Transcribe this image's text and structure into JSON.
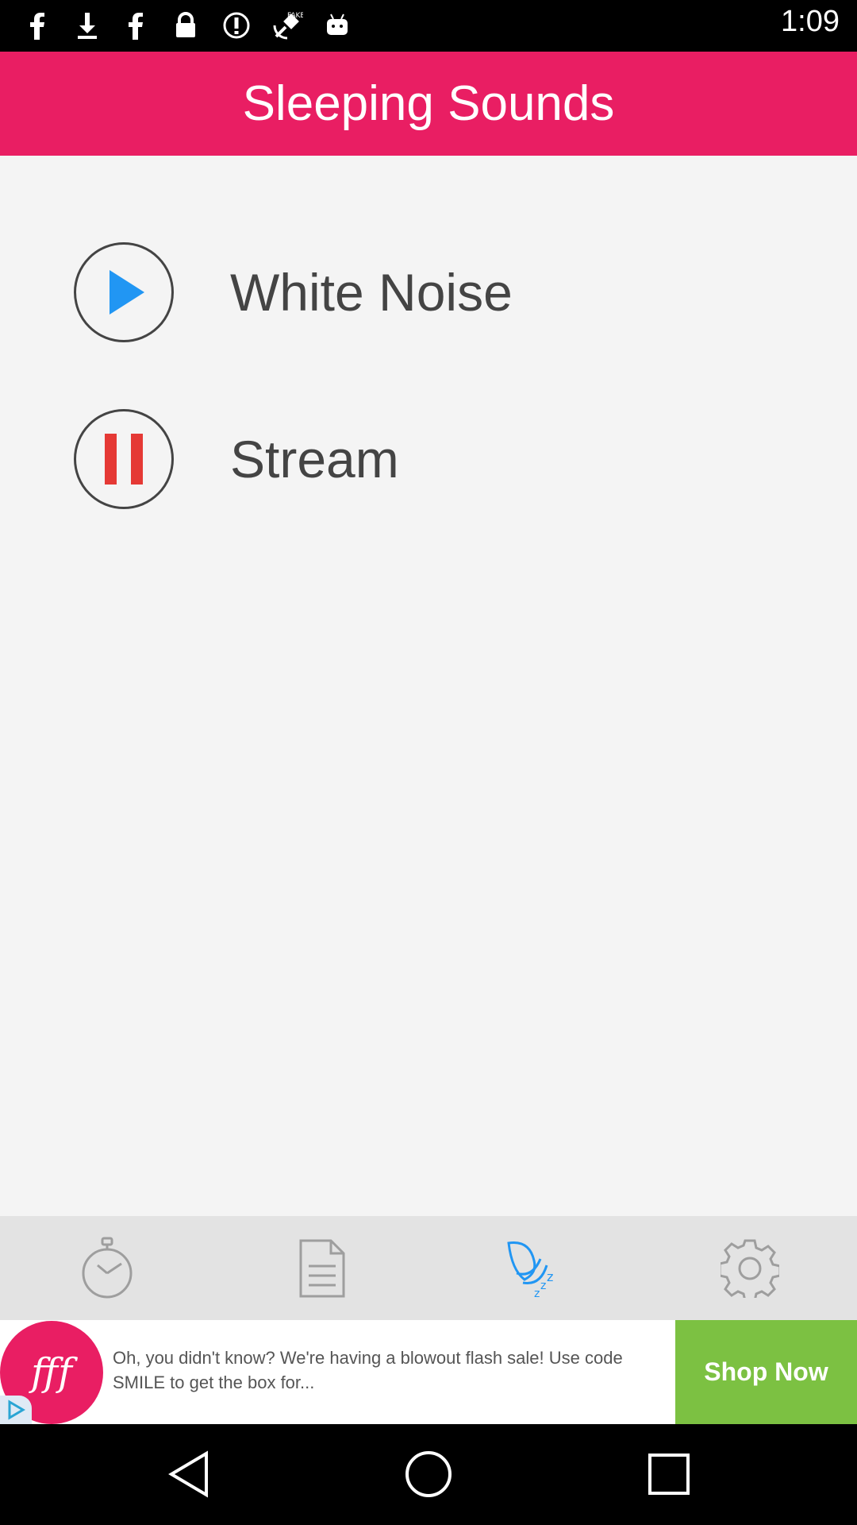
{
  "status_bar": {
    "time": "1:09",
    "icons": [
      "facebook-icon",
      "download-icon",
      "facebook-icon",
      "lock-icon",
      "info-circle-icon",
      "fake-gps-icon",
      "android-icon"
    ]
  },
  "app_bar": {
    "title": "Sleeping Sounds",
    "color": "#e91e63"
  },
  "sounds": [
    {
      "label": "White Noise",
      "state": "play",
      "icon_color": "#2196f3"
    },
    {
      "label": "Stream",
      "state": "pause",
      "icon_color": "#e53935"
    }
  ],
  "bottom_nav": {
    "items": [
      {
        "name": "timer",
        "icon": "stopwatch-icon",
        "active": false
      },
      {
        "name": "list",
        "icon": "document-icon",
        "active": false
      },
      {
        "name": "sounds",
        "icon": "sleeping-sound-icon",
        "active": true
      },
      {
        "name": "settings",
        "icon": "gear-icon",
        "active": false
      }
    ],
    "active_color": "#2196f3",
    "inactive_color": "#9e9e9e"
  },
  "ad": {
    "logo_text": "fff",
    "text": "Oh, you didn't know? We're having a blowout flash sale! Use code SMILE to get the box for...",
    "cta": "Shop Now",
    "cta_color": "#7cc142"
  },
  "system_nav": {
    "icons": [
      "back-icon",
      "home-icon",
      "recents-icon"
    ]
  }
}
